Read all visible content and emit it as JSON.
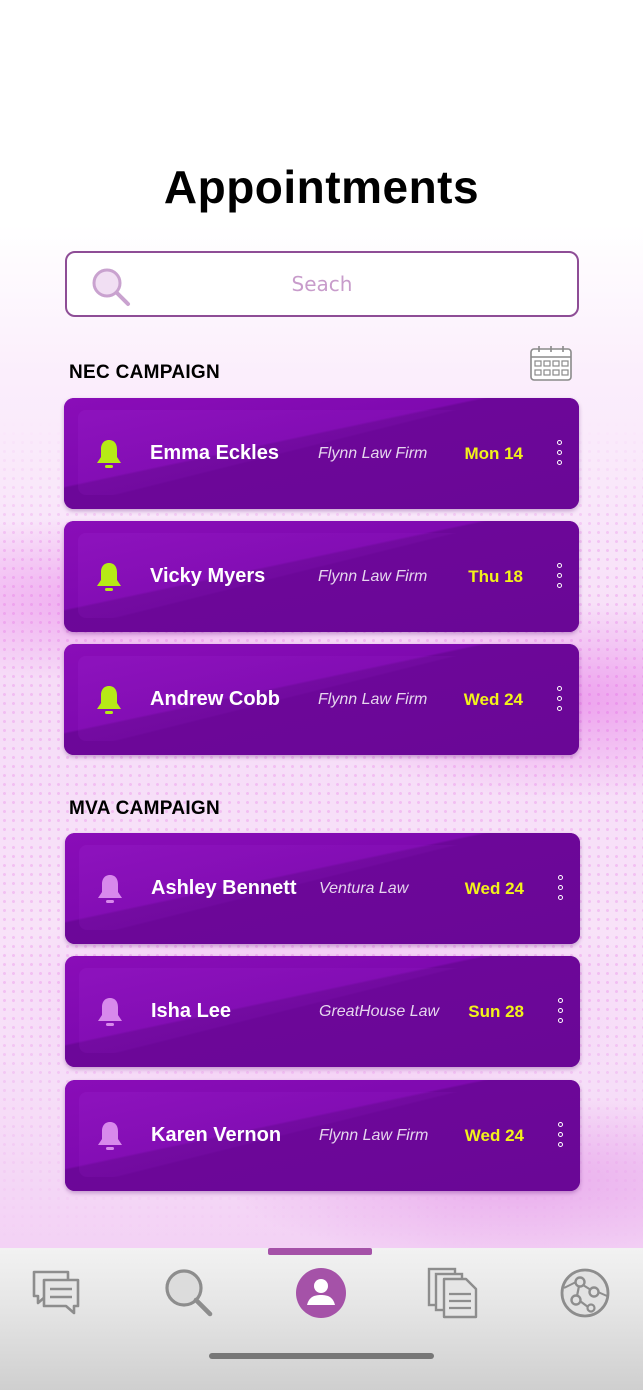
{
  "header": {
    "title": "Appointments"
  },
  "search": {
    "placeholder": "Seach"
  },
  "colors": {
    "card": "#6a0796",
    "date": "#f2f21a",
    "bell_active": "#b6ea16",
    "bell_muted": "#d889ec",
    "accent": "#a552a8"
  },
  "sections": [
    {
      "label": "NEC CAMPAIGN",
      "appointments": [
        {
          "name": "Emma Eckles",
          "firm": "Flynn Law Firm",
          "date": "Mon 14",
          "bell": "bell-active"
        },
        {
          "name": "Vicky Myers",
          "firm": "Flynn Law Firm",
          "date": "Thu 18",
          "bell": "bell-active"
        },
        {
          "name": "Andrew Cobb",
          "firm": "Flynn Law Firm",
          "date": "Wed 24",
          "bell": "bell-active"
        }
      ]
    },
    {
      "label": "MVA CAMPAIGN",
      "appointments": [
        {
          "name": "Ashley Bennett",
          "firm": "Ventura Law",
          "date": "Wed 24",
          "bell": "bell-muted"
        },
        {
          "name": "Isha Lee",
          "firm": "GreatHouse Law",
          "date": "Sun 28",
          "bell": "bell-muted"
        },
        {
          "name": "Karen Vernon",
          "firm": "Flynn Law Firm",
          "date": "Wed 24",
          "bell": "bell-muted"
        }
      ]
    }
  ],
  "tabbar": {
    "tabs": [
      {
        "icon": "chat-icon",
        "active": false
      },
      {
        "icon": "search-icon",
        "active": false
      },
      {
        "icon": "profile-icon",
        "active": true
      },
      {
        "icon": "documents-icon",
        "active": false
      },
      {
        "icon": "network-icon",
        "active": false
      }
    ]
  }
}
